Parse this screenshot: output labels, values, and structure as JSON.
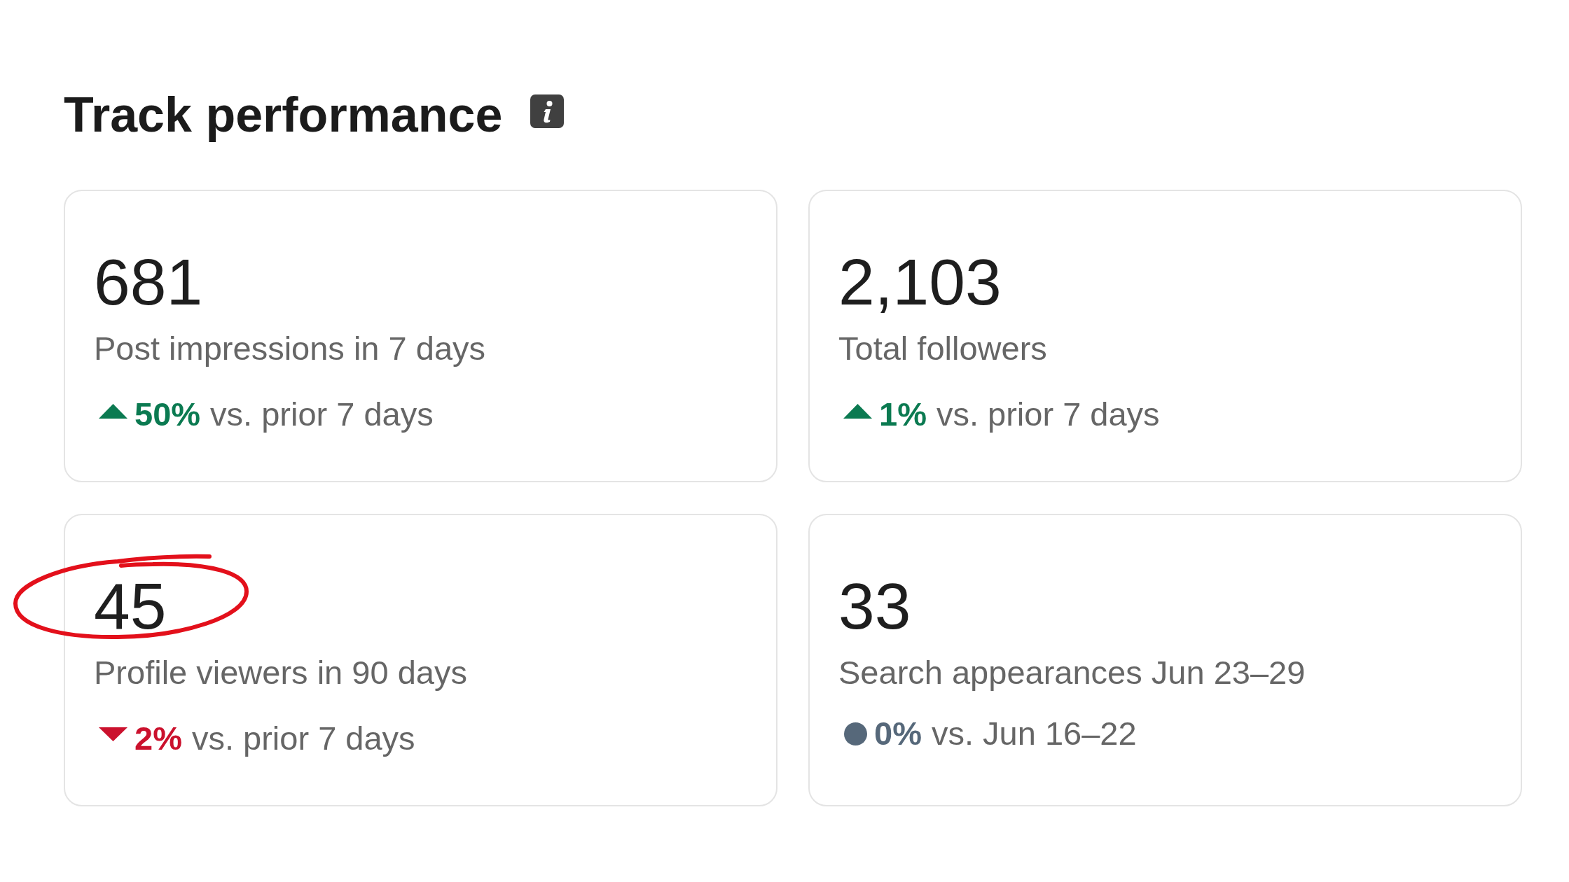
{
  "title": "Track performance",
  "cards": [
    {
      "value": "681",
      "label": "Post impressions in 7 days",
      "kind": "up",
      "change": "50%",
      "comparison": "vs. prior 7 days",
      "circled": false
    },
    {
      "value": "2,103",
      "label": "Total followers",
      "kind": "up",
      "change": "1%",
      "comparison": "vs. prior 7 days",
      "circled": false
    },
    {
      "value": "45",
      "label": "Profile viewers in 90 days",
      "kind": "down",
      "change": "2%",
      "comparison": "vs. prior 7 days",
      "circled": true
    },
    {
      "value": "33",
      "label": "Search appearances Jun 23–29",
      "kind": "flat",
      "change": "0%",
      "comparison": "vs. Jun 16–22",
      "circled": false
    }
  ]
}
